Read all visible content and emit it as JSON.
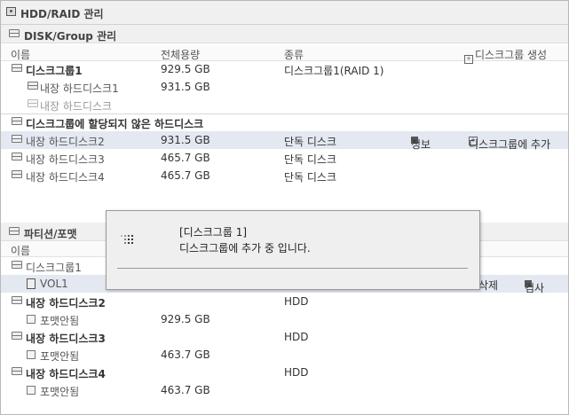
{
  "window_title": "HDD/RAID 관리",
  "disk_group_section": {
    "title": "DISK/Group 관리",
    "columns": [
      "이름",
      "전체용량",
      "종류"
    ],
    "create_button": "디스크그룹 생성",
    "groups": [
      {
        "name": "디스크그룹1",
        "size": "929.5 GB",
        "type": "디스크그룹1(RAID 1)"
      },
      {
        "name": "내장 하드디스크1",
        "size": "931.5 GB",
        "type": ""
      },
      {
        "name": "내장 하드디스크",
        "size": "",
        "type": ""
      }
    ],
    "unassigned_title": "디스크그룹에 할당되지 않은 하드디스크",
    "unassigned": [
      {
        "name": "내장 하드디스크2",
        "size": "931.5 GB",
        "type": "단독 디스크",
        "info": "정보",
        "add": "디스크그룹에 추가"
      },
      {
        "name": "내장 하드디스크3",
        "size": "465.7 GB",
        "type": "단독 디스크"
      },
      {
        "name": "내장 하드디스크4",
        "size": "465.7 GB",
        "type": "단독 디스크"
      }
    ]
  },
  "partition_section": {
    "title": "파티션/포맷",
    "column_name": "이름",
    "group_name": "디스크그룹1",
    "volume": {
      "name": "VOL1",
      "delete": "삭제",
      "check": "검사"
    },
    "disks": [
      {
        "name": "내장 하드디스크2",
        "type": "HDD",
        "child": "포맷안됨",
        "size": "929.5 GB"
      },
      {
        "name": "내장 하드디스크3",
        "type": "HDD",
        "child": "포맷안됨",
        "size": "463.7 GB"
      },
      {
        "name": "내장 하드디스크4",
        "type": "HDD",
        "child": "포맷안됨",
        "size": "463.7 GB"
      }
    ]
  },
  "dialog": {
    "line1": "[디스크그룹 1]",
    "line2": "디스크그룹에 추가 중 입니다."
  }
}
